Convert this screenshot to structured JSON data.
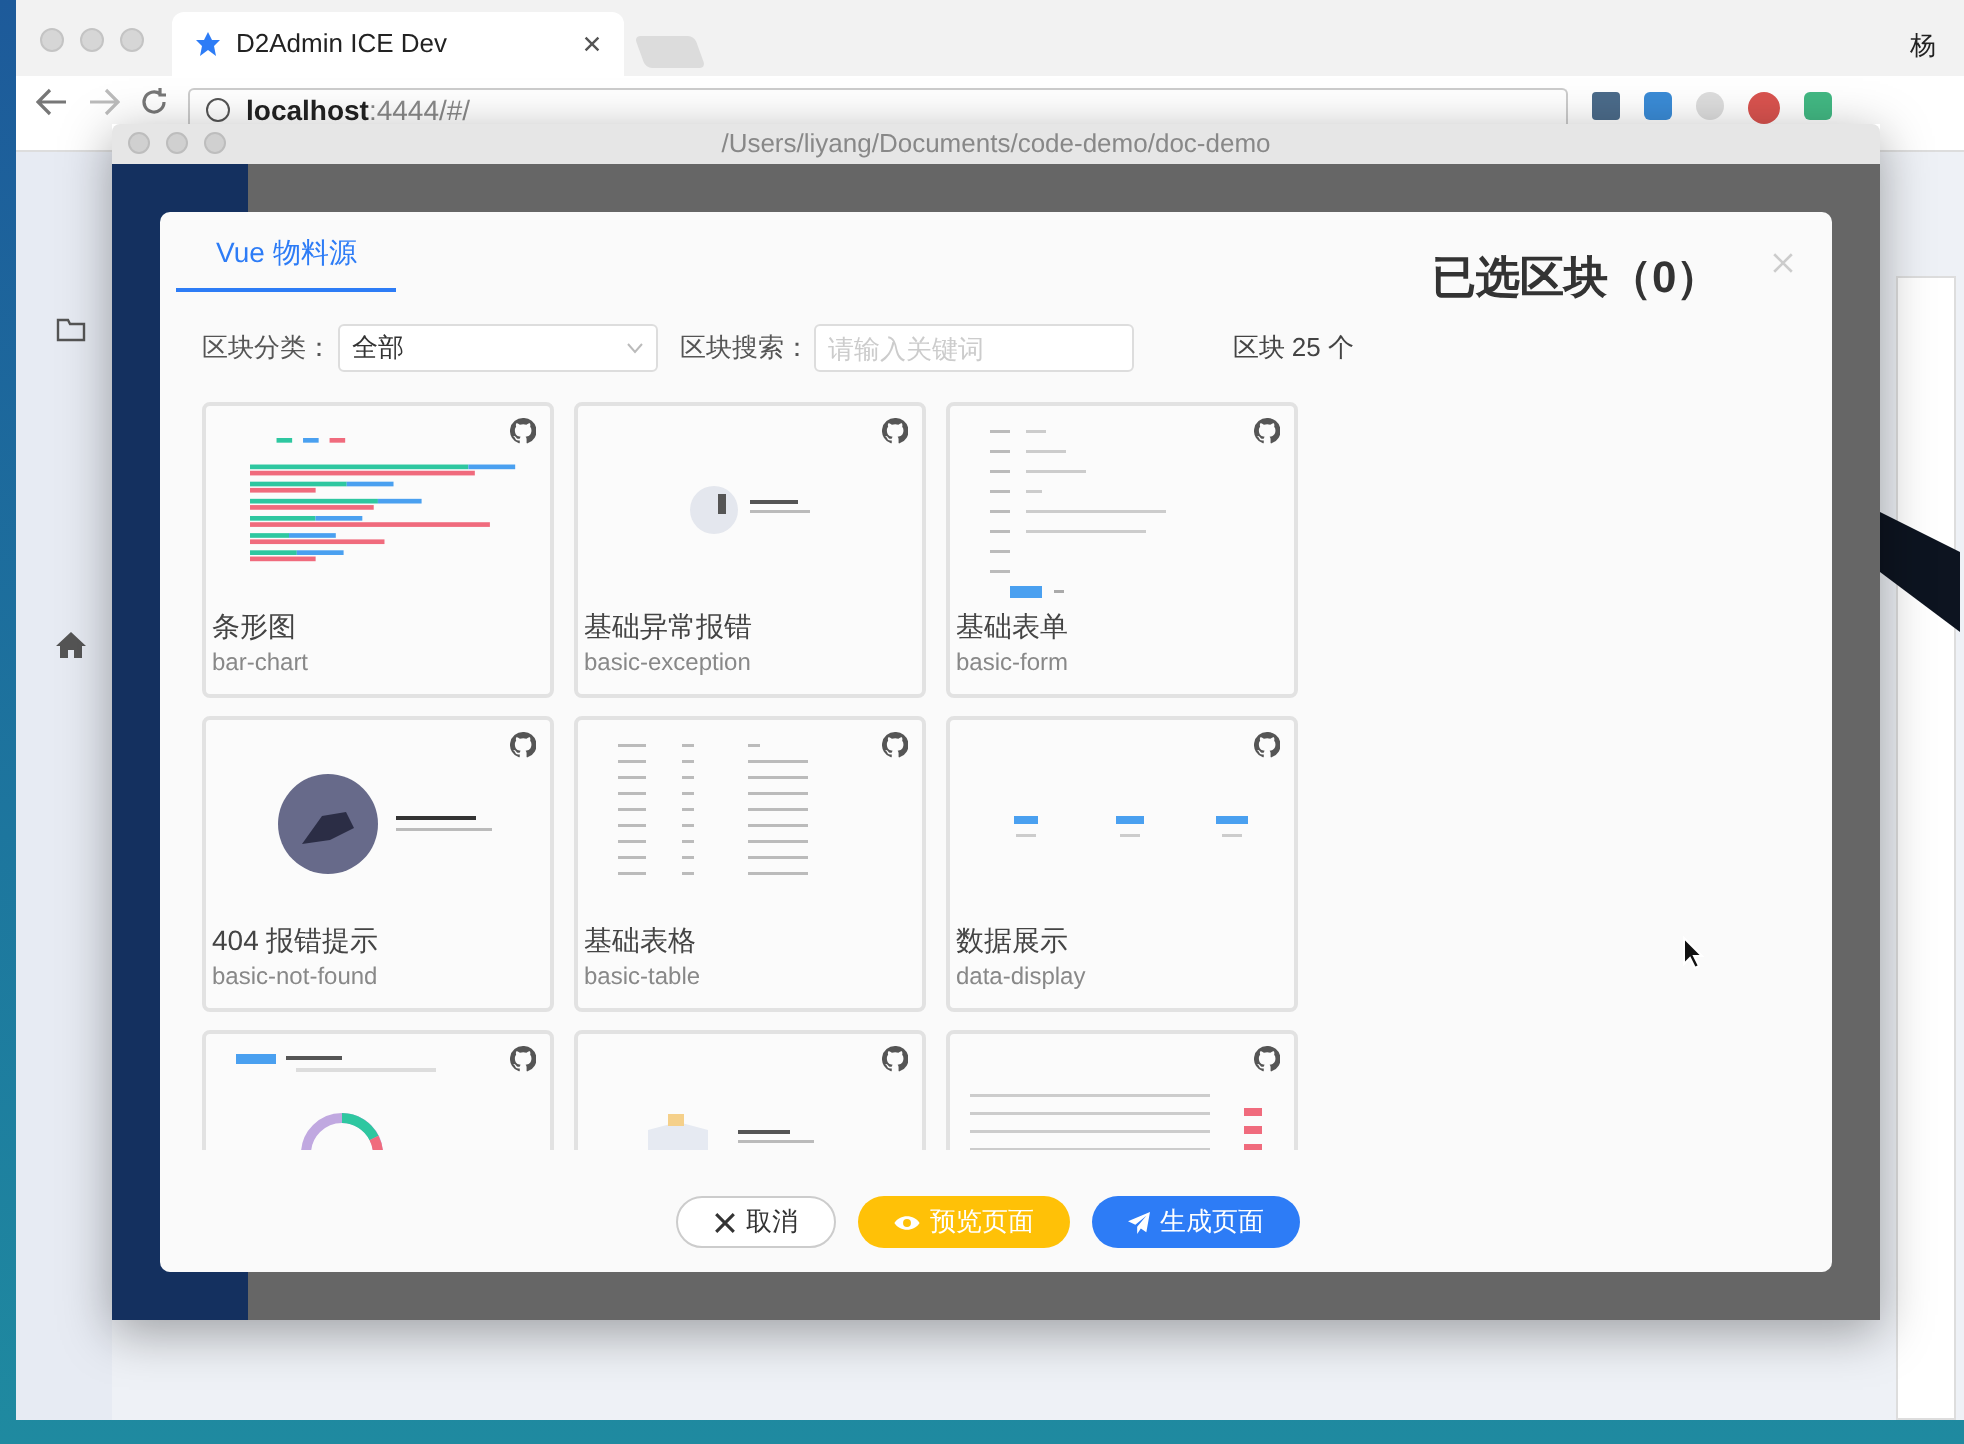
{
  "browser": {
    "tabs": [
      {
        "title": "D2Admin ICE Dev",
        "selected": true
      }
    ],
    "profile": "杨",
    "address": {
      "host": "localhost",
      "rest": ":4444/#/"
    }
  },
  "app_window": {
    "title": "/Users/liyang/Documents/code-demo/doc-demo"
  },
  "dialog": {
    "tabs": [
      {
        "label": "Vue 物料源",
        "selected": true
      }
    ],
    "selected_title": "已选区块（0）",
    "filters": {
      "category_label": "区块分类：",
      "category_value": "全部",
      "search_label": "区块搜索：",
      "search_placeholder": "请输入关键词",
      "count": "区块 25 个"
    },
    "blocks": [
      {
        "title": "条形图",
        "name": "bar-chart",
        "kind": "bars"
      },
      {
        "title": "基础异常报错",
        "name": "basic-exception",
        "kind": "exception"
      },
      {
        "title": "基础表单",
        "name": "basic-form",
        "kind": "form"
      },
      {
        "title": "404 报错提示",
        "name": "basic-not-found",
        "kind": "notfound"
      },
      {
        "title": "基础表格",
        "name": "basic-table",
        "kind": "table"
      },
      {
        "title": "数据展示",
        "name": "data-display",
        "kind": "stats"
      },
      {
        "kind": "donut"
      },
      {
        "kind": "empty"
      },
      {
        "kind": "actions"
      }
    ],
    "buttons": [
      {
        "label": "取消",
        "kind": "cancel"
      },
      {
        "label": "预览页面",
        "kind": "preview"
      },
      {
        "label": "生成页面",
        "kind": "generate"
      }
    ]
  }
}
